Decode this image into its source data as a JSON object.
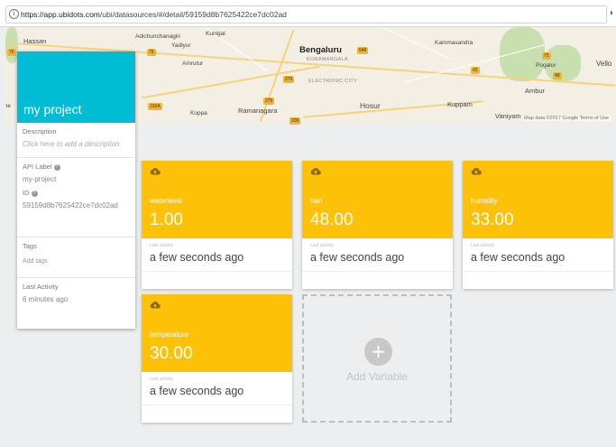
{
  "browser": {
    "url_host": "https://app.ubidots.com",
    "url_path": "/ubi/datasources/#/detail/59159d8b7625422ce7dc02ad"
  },
  "map": {
    "labels": [
      "Hassan",
      "Adichunchanagiri",
      "Kunigal",
      "Yadiyur",
      "Amrutur",
      "Bengaluru",
      "KORAMANGALA",
      "ELECTRONIC CITY",
      "Kammasandra",
      "Pogalur",
      "Vello",
      "Ambur",
      "Kuppam",
      "Hosur",
      "Koppa",
      "Ramanagara",
      "Vaniyam",
      "the"
    ],
    "shields": [
      "75",
      "75",
      "648",
      "275",
      "275",
      "150A",
      "209",
      "75",
      "42",
      "48"
    ],
    "attribution": "Map data ©2017 Google   Terms of Use"
  },
  "project": {
    "title": "my project",
    "description_label": "Description",
    "description_placeholder": "Click here to add a description",
    "api_label_title": "API Label",
    "api_label_value": "my-project",
    "id_title": "ID",
    "id_value": "59159d8b7625422ce7dc02ad",
    "tags_title": "Tags",
    "tags_placeholder": "Add tags",
    "last_activity_title": "Last Activity",
    "last_activity_value": "6 minutes ago"
  },
  "variables": [
    {
      "name": "waterlevel",
      "value": "1.00",
      "activity_label": "Last activity",
      "activity": "a few seconds ago"
    },
    {
      "name": "rain",
      "value": "48.00",
      "activity_label": "Last activity",
      "activity": "a few seconds ago"
    },
    {
      "name": "humidity",
      "value": "33.00",
      "activity_label": "Last activity",
      "activity": "a few seconds ago"
    },
    {
      "name": "temperature",
      "value": "30.00",
      "activity_label": "Last activity",
      "activity": "a few seconds ago"
    }
  ],
  "add_variable": {
    "label": "Add Variable",
    "icon": "+"
  },
  "colors": {
    "accent": "#00bcd4",
    "card": "#fdc108"
  }
}
